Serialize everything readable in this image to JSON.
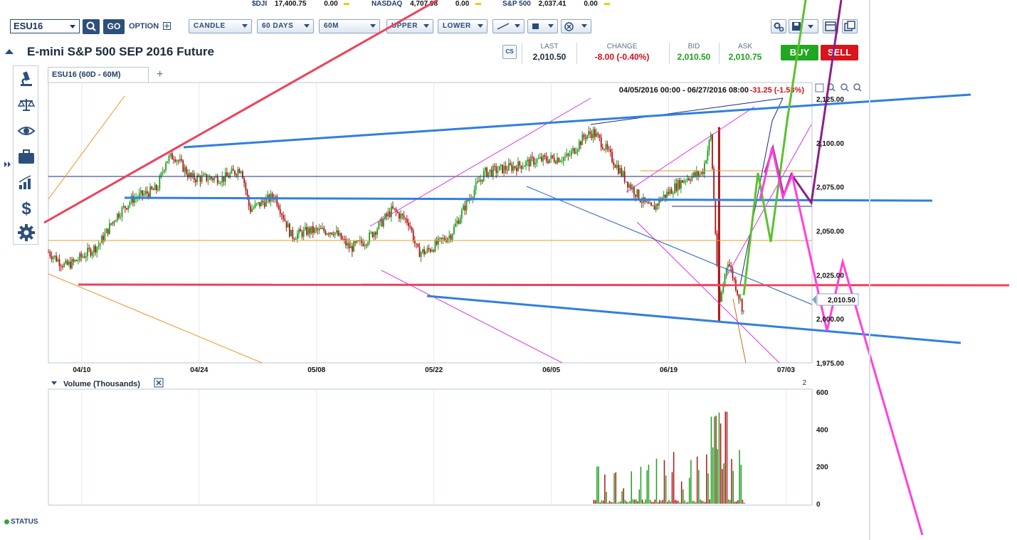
{
  "ticker": [
    {
      "label": "$DJI",
      "value": "17,400.75",
      "change": "0.00"
    },
    {
      "label": "NASDAQ",
      "value": "4,707.98",
      "change": "0.00"
    },
    {
      "label": "S&P 500",
      "value": "2,037.41",
      "change": "0.00"
    }
  ],
  "toolbar": {
    "symbol": "ESU16",
    "go_label": "GO",
    "option_label": "OPTION",
    "chart_type": "CANDLE",
    "range": "60 DAYS",
    "interval": "60M",
    "upper": "UPPER",
    "lower": "LOWER"
  },
  "quote": {
    "title": "E-mini S&P 500 SEP 2016 Future",
    "cs_label": "CS",
    "last_label": "LAST",
    "last": "2,010.50",
    "change_label": "CHANGE",
    "change": "-8.00 (-0.40%)",
    "bid_label": "BID",
    "bid": "2,010.50",
    "ask_label": "ASK",
    "ask": "2,010.75",
    "buy_label": "BUY",
    "sell_label": "SELL"
  },
  "colors": {
    "up": "#1e9e1e",
    "down": "#b01414",
    "accent": "#2d4f7c",
    "price_line_blue": "#2f7fe0",
    "price_line_red": "#f0405a"
  },
  "side_icons": [
    "microscope-icon",
    "scales-icon",
    "eye-icon",
    "briefcase-icon",
    "bar-chart-icon",
    "dollar-icon",
    "gear-icon"
  ],
  "chart": {
    "tab_label": "ESU16 (60D - 60M)",
    "add_tab": "+",
    "range_info": "04/05/2016 00:00 - 06/27/2016 08:00",
    "range_change": "-31.25 (-1.53%)",
    "current_price_label": "2,010.50",
    "volume_title": "Volume (Thousands)",
    "volume_pane_index": "2",
    "status": "STATUS"
  },
  "chart_data": [
    {
      "type": "candlestick",
      "title": "ESU16 (60D - 60M)",
      "x_labels": [
        "04/10",
        "04/24",
        "05/08",
        "05/22",
        "06/05",
        "06/19",
        "07/03"
      ],
      "y_ticks": [
        "2,125.00",
        "2,100.00",
        "2,075.00",
        "2,050.00",
        "2,025.00",
        "2,000.00",
        "1,975.00"
      ],
      "ylim": [
        1975,
        2125
      ],
      "date_range": [
        "2016-04-05",
        "2016-06-27"
      ],
      "approx_closes": [
        [
          "2016-04-05",
          2038
        ],
        [
          "2016-04-07",
          2030
        ],
        [
          "2016-04-08",
          2032
        ],
        [
          "2016-04-11",
          2042
        ],
        [
          "2016-04-13",
          2058
        ],
        [
          "2016-04-15",
          2068
        ],
        [
          "2016-04-18",
          2074
        ],
        [
          "2016-04-19",
          2090
        ],
        [
          "2016-04-20",
          2093
        ],
        [
          "2016-04-22",
          2080
        ],
        [
          "2016-04-26",
          2080
        ],
        [
          "2016-04-28",
          2086
        ],
        [
          "2016-04-29",
          2062
        ],
        [
          "2016-05-02",
          2070
        ],
        [
          "2016-05-04",
          2047
        ],
        [
          "2016-05-06",
          2050
        ],
        [
          "2016-05-09",
          2050
        ],
        [
          "2016-05-11",
          2040
        ],
        [
          "2016-05-13",
          2045
        ],
        [
          "2016-05-16",
          2062
        ],
        [
          "2016-05-18",
          2055
        ],
        [
          "2016-05-19",
          2038
        ],
        [
          "2016-05-20",
          2038
        ],
        [
          "2016-05-23",
          2048
        ],
        [
          "2016-05-25",
          2067
        ],
        [
          "2016-05-27",
          2083
        ],
        [
          "2016-05-31",
          2087
        ],
        [
          "2016-06-02",
          2090
        ],
        [
          "2016-06-06",
          2092
        ],
        [
          "2016-06-08",
          2104
        ],
        [
          "2016-06-09",
          2106
        ],
        [
          "2016-06-10",
          2100
        ],
        [
          "2016-06-13",
          2078
        ],
        [
          "2016-06-14",
          2072
        ],
        [
          "2016-06-15",
          2066
        ],
        [
          "2016-06-16",
          2062
        ],
        [
          "2016-06-17",
          2068
        ],
        [
          "2016-06-20",
          2080
        ],
        [
          "2016-06-22",
          2083
        ],
        [
          "2016-06-23",
          2104
        ],
        [
          "2016-06-24",
          2006
        ],
        [
          "2016-06-25",
          2034
        ],
        [
          "2016-06-27",
          2003
        ]
      ],
      "current_price": 2010.5
    },
    {
      "type": "bar",
      "title": "Volume (Thousands)",
      "y_ticks": [
        "600",
        "400",
        "200",
        "0"
      ],
      "ylim": [
        0,
        600
      ]
    }
  ]
}
